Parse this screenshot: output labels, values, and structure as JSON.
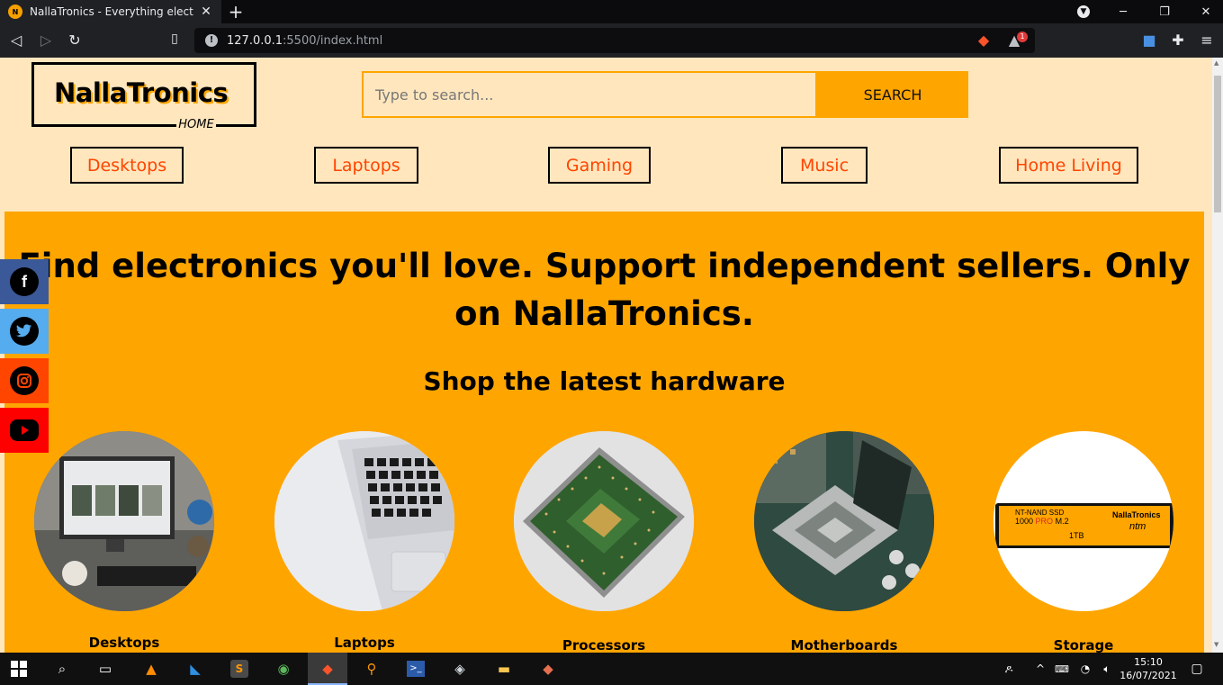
{
  "browser": {
    "tab_title": "NallaTronics - Everything electronics",
    "url_host": "127.0.0.1",
    "url_rest": ":5500/index.html",
    "shield_badge": "1"
  },
  "header": {
    "logo_name": "NallaTronics",
    "logo_home": "HOME",
    "search_placeholder": "Type to search...",
    "search_button": "SEARCH"
  },
  "categories": [
    {
      "label": "Desktops"
    },
    {
      "label": "Laptops"
    },
    {
      "label": "Gaming"
    },
    {
      "label": "Music"
    },
    {
      "label": "Home Living"
    }
  ],
  "hero": {
    "headline": "Find electronics you'll love. Support independent sellers. Only on NallaTronics.",
    "subheadline": "Shop the latest hardware",
    "products": [
      {
        "label": "Desktops"
      },
      {
        "label": "Laptops"
      },
      {
        "label": "Processors"
      },
      {
        "label": "Motherboards"
      },
      {
        "label": "Storage"
      }
    ],
    "ssd_text": {
      "line1": "NT-NAND SSD",
      "line2a": "1000",
      "line2b": "PRO",
      "line2c": "M.2",
      "brand": "NallaTronics",
      "cap": "1TB",
      "tag": "ntm"
    }
  },
  "social": [
    {
      "icon": "facebook-icon",
      "glyph": "f",
      "color": "#3b5998"
    },
    {
      "icon": "twitter-icon",
      "glyph": "t",
      "color": "#55acee"
    },
    {
      "icon": "instagram-icon",
      "glyph": "◎",
      "color": "#ff4500"
    },
    {
      "icon": "youtube-icon",
      "glyph": "▶",
      "color": "#ff0000"
    }
  ],
  "taskbar": {
    "time": "15:10",
    "date": "16/07/2021"
  },
  "colors": {
    "accent": "#ffa500",
    "page_bg": "#ffe6bd",
    "link": "#ff4500"
  }
}
